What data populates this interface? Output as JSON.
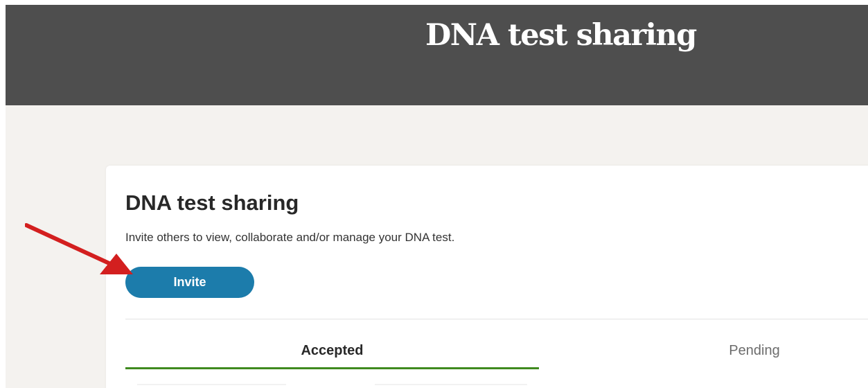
{
  "header": {
    "title": "DNA test sharing"
  },
  "card": {
    "title": "DNA test sharing",
    "description": "Invite others to view, collaborate and/or manage your DNA test.",
    "invite_label": "Invite"
  },
  "tabs": [
    {
      "label": "Accepted",
      "active": true
    },
    {
      "label": "Pending",
      "active": false
    }
  ],
  "colors": {
    "header_bg": "#4e4e4e",
    "page_bg": "#f4f2ef",
    "button_bg": "#1c7cab",
    "active_tab_underline": "#3f8a1f",
    "annotation_arrow": "#d31f1f"
  },
  "annotation": {
    "icon": "red-arrow-icon"
  }
}
